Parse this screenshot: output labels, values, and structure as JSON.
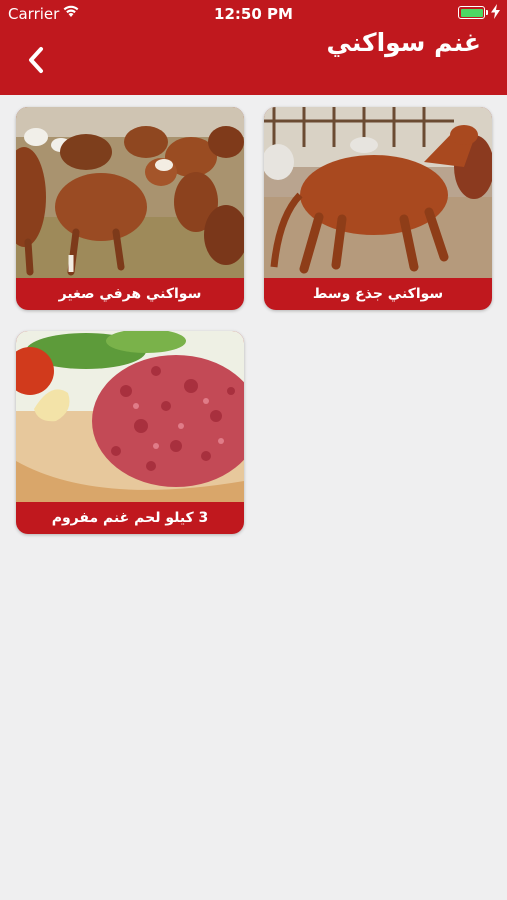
{
  "status_bar": {
    "carrier": "Carrier",
    "time": "12:50 PM"
  },
  "header": {
    "title": "غنم سواكني",
    "back_icon": "chevron-left-icon"
  },
  "products": [
    {
      "name": "سواكني جذع وسط",
      "image": "brown-goat-photo"
    },
    {
      "name": "سواكني هرفي صغير",
      "image": "goat-herd-photo"
    },
    {
      "name": "3 كيلو لحم غنم مفروم",
      "image": "minced-meat-photo"
    }
  ],
  "colors": {
    "header": "#c0181e",
    "background": "#efeff0",
    "card_label": "#c0181e"
  }
}
